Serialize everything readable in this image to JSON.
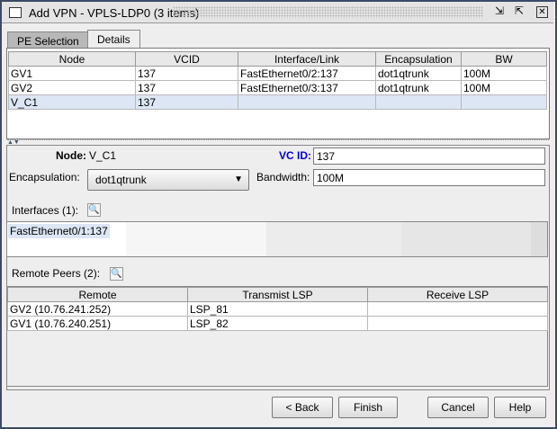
{
  "window": {
    "title": "Add VPN - VPLS-LDP0 (3 items)"
  },
  "tabs": [
    {
      "label": "PE Selection",
      "active": false
    },
    {
      "label": "Details",
      "active": true
    }
  ],
  "nodes_table": {
    "headers": [
      "Node",
      "VCID",
      "Interface/Link",
      "Encapsulation",
      "BW"
    ],
    "rows": [
      [
        "GV1",
        "137",
        "FastEthernet0/2:137",
        "dot1qtrunk",
        "100M"
      ],
      [
        "GV2",
        "137",
        "FastEthernet0/3:137",
        "dot1qtrunk",
        "100M"
      ],
      [
        "V_C1",
        "137",
        "",
        "",
        ""
      ]
    ],
    "selected_row": 2
  },
  "details": {
    "node_label": "Node:",
    "node_value": "V_C1",
    "vcid_label": "VC ID:",
    "vcid_value": "137",
    "encap_label": "Encapsulation:",
    "encap_value": "dot1qtrunk",
    "bw_label": "Bandwidth:",
    "bw_value": "100M",
    "interfaces_label": "Interfaces (1):",
    "interfaces": [
      "FastEthernet0/1:137"
    ],
    "peers_label": "Remote Peers (2):"
  },
  "peers_table": {
    "headers": [
      "Remote",
      "Transmist LSP",
      "Receive LSP"
    ],
    "rows": [
      [
        "GV2 (10.76.241.252)",
        "LSP_81",
        ""
      ],
      [
        "GV1 (10.76.240.251)",
        "LSP_82",
        ""
      ]
    ]
  },
  "buttons": {
    "back": "< Back",
    "finish": "Finish",
    "cancel": "Cancel",
    "help": "Help"
  },
  "colors": {
    "vcid_label": "#0000cc",
    "selected_row": "#dde6f4"
  }
}
